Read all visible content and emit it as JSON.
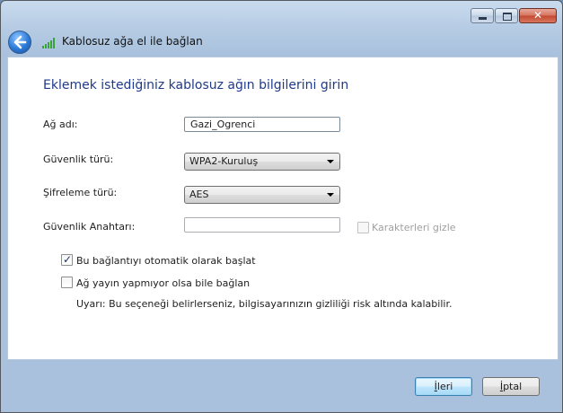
{
  "nav": {
    "title": "Kablosuz ağa el ile bağlan"
  },
  "heading": "Eklemek istediğiniz kablosuz ağın bilgilerini girin",
  "fields": {
    "network_name": {
      "label": "Ağ adı:",
      "value": "Gazi_Ogrenci"
    },
    "security_type": {
      "label": "Güvenlik türü:",
      "value": "WPA2-Kuruluş"
    },
    "encryption_type": {
      "label": "Şifreleme türü:",
      "value": "AES"
    },
    "security_key": {
      "label": "Güvenlik Anahtarı:",
      "value": ""
    }
  },
  "hide_chars": {
    "label": "Karakterleri gizle",
    "checked": false,
    "disabled": true
  },
  "options": {
    "auto_connect": {
      "label": "Bu bağlantıyı otomatik olarak başlat",
      "checked": true
    },
    "connect_hidden": {
      "label": "Ağ yayın yapmıyor olsa bile bağlan",
      "checked": false
    },
    "warning": "Uyarı: Bu seçeneği belirlerseniz, bilgisayarınızın gizliliği risk altında kalabilir."
  },
  "buttons": {
    "next": {
      "first": "İ",
      "rest": "leri"
    },
    "cancel": {
      "first": "İ",
      "rest": "ptal"
    }
  },
  "colors": {
    "heading": "#1e3a8a",
    "accent": "#2b7ad8"
  }
}
